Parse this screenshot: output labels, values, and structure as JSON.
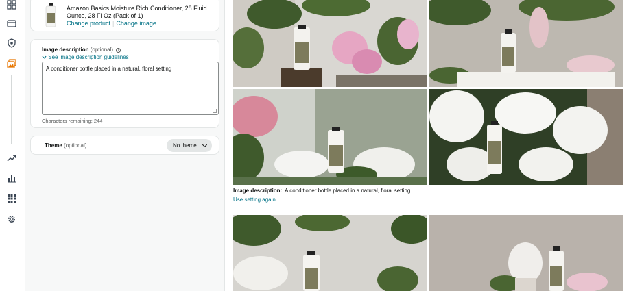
{
  "product": {
    "title": "Amazon Basics Moisture Rich Conditioner, 28 Fluid Ounce, 28 Fl Oz (Pack of 1)",
    "change_product": "Change product",
    "change_image": "Change image"
  },
  "description": {
    "label": "Image description",
    "optional": "(optional)",
    "guidelines_link": "See image description guidelines",
    "value": "A conditioner bottle placed in a natural, floral setting",
    "chars_remaining": "Characters remaining: 244"
  },
  "theme": {
    "label": "Theme",
    "optional": "(optional)",
    "selected": "No theme"
  },
  "result": {
    "caption_label": "Image description:",
    "caption_value": "A conditioner bottle placed in a natural, floral setting",
    "reuse_link": "Use setting again"
  },
  "rail_icons": [
    "grid-dashboard-icon",
    "wallet-icon",
    "shield-icon",
    "image-gallery-icon",
    "trend-icon",
    "bar-chart-icon",
    "apps-grid-icon",
    "gear-icon"
  ],
  "colors": {
    "link": "#007185",
    "bottle_label": "#7d7b5c",
    "rail_active": "#e77600"
  }
}
